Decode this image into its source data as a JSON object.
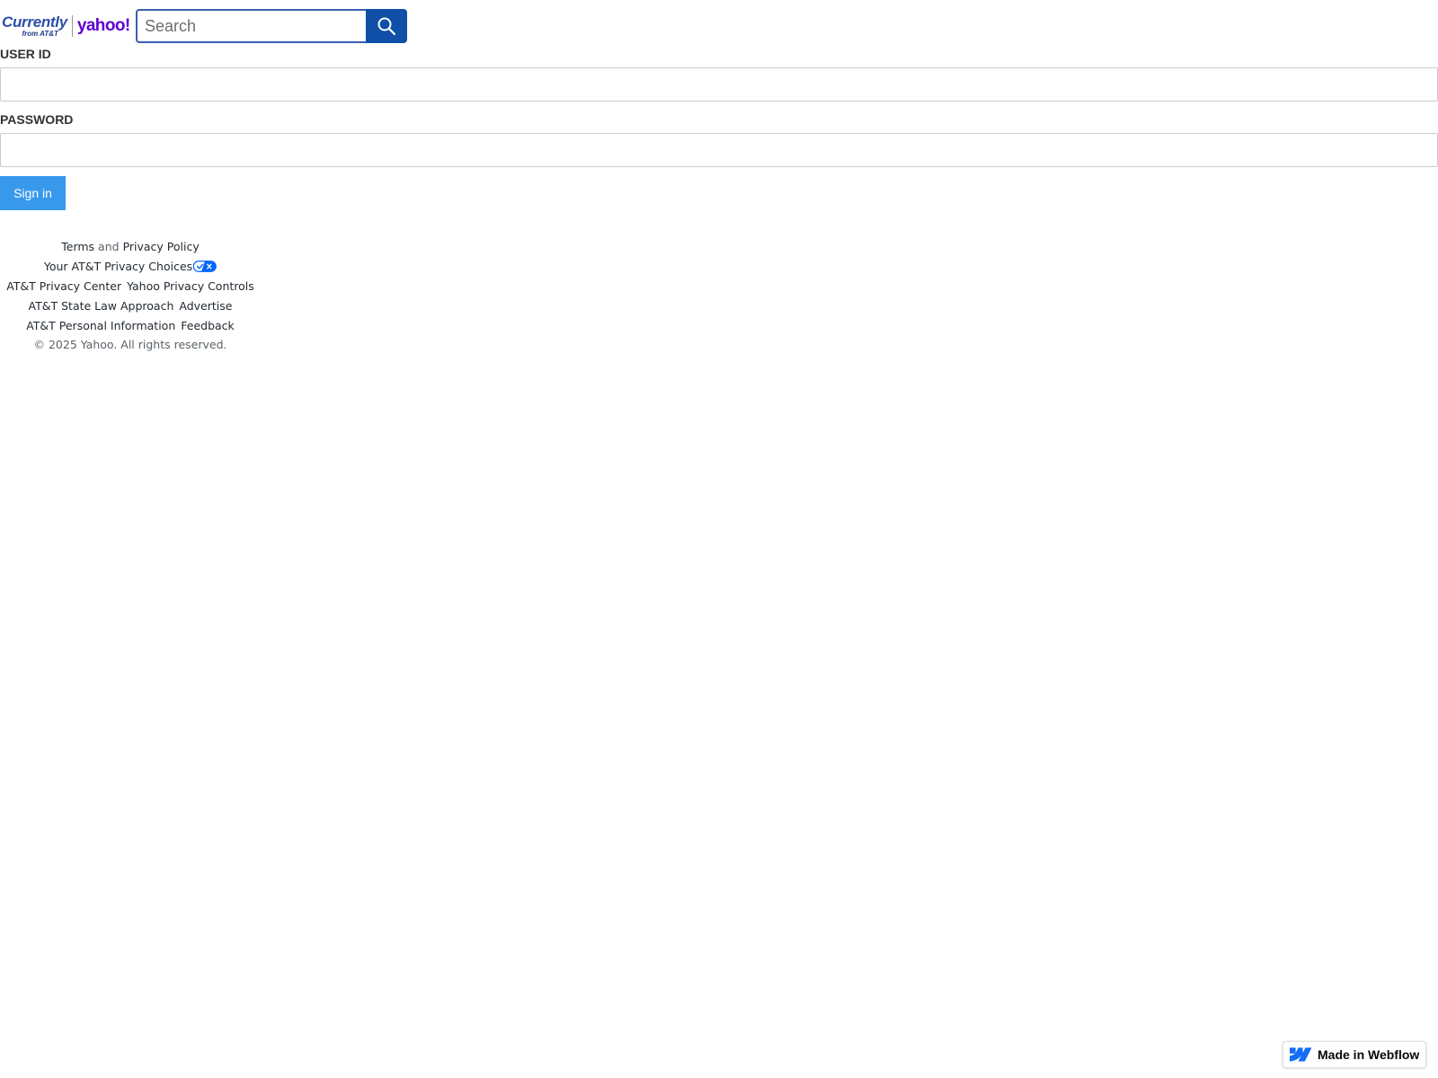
{
  "header": {
    "logo": {
      "brand_main": "Currently",
      "brand_sub": "from AT&T",
      "partner": "yahoo!"
    },
    "search": {
      "placeholder": "Search",
      "value": ""
    }
  },
  "form": {
    "user_id_label": "USER ID",
    "user_id_value": "",
    "password_label": "PASSWORD",
    "password_value": "",
    "signin_label": "Sign in"
  },
  "footer": {
    "terms": "Terms",
    "and": "and",
    "privacy_policy": "Privacy Policy",
    "privacy_choices": "Your AT&T Privacy Choices",
    "att_privacy_center": "AT&T Privacy Center",
    "yahoo_privacy_controls": "Yahoo Privacy Controls",
    "att_state_law": "AT&T State Law Approach",
    "advertise": "Advertise",
    "att_personal_info": "AT&T Personal Information",
    "feedback": "Feedback",
    "copyright": "© 2025 Yahoo. All rights reserved."
  },
  "badge": {
    "label": "Made in Webflow"
  },
  "colors": {
    "yahoo_purple": "#6001d2",
    "search_blue": "#0f4fa8",
    "signin_blue": "#3898ec",
    "currently_blue": "#2a4fa6"
  },
  "icons": {
    "search": "search-icon",
    "privacy_choices": "privacy-choices-icon",
    "webflow": "webflow-logo-icon"
  }
}
